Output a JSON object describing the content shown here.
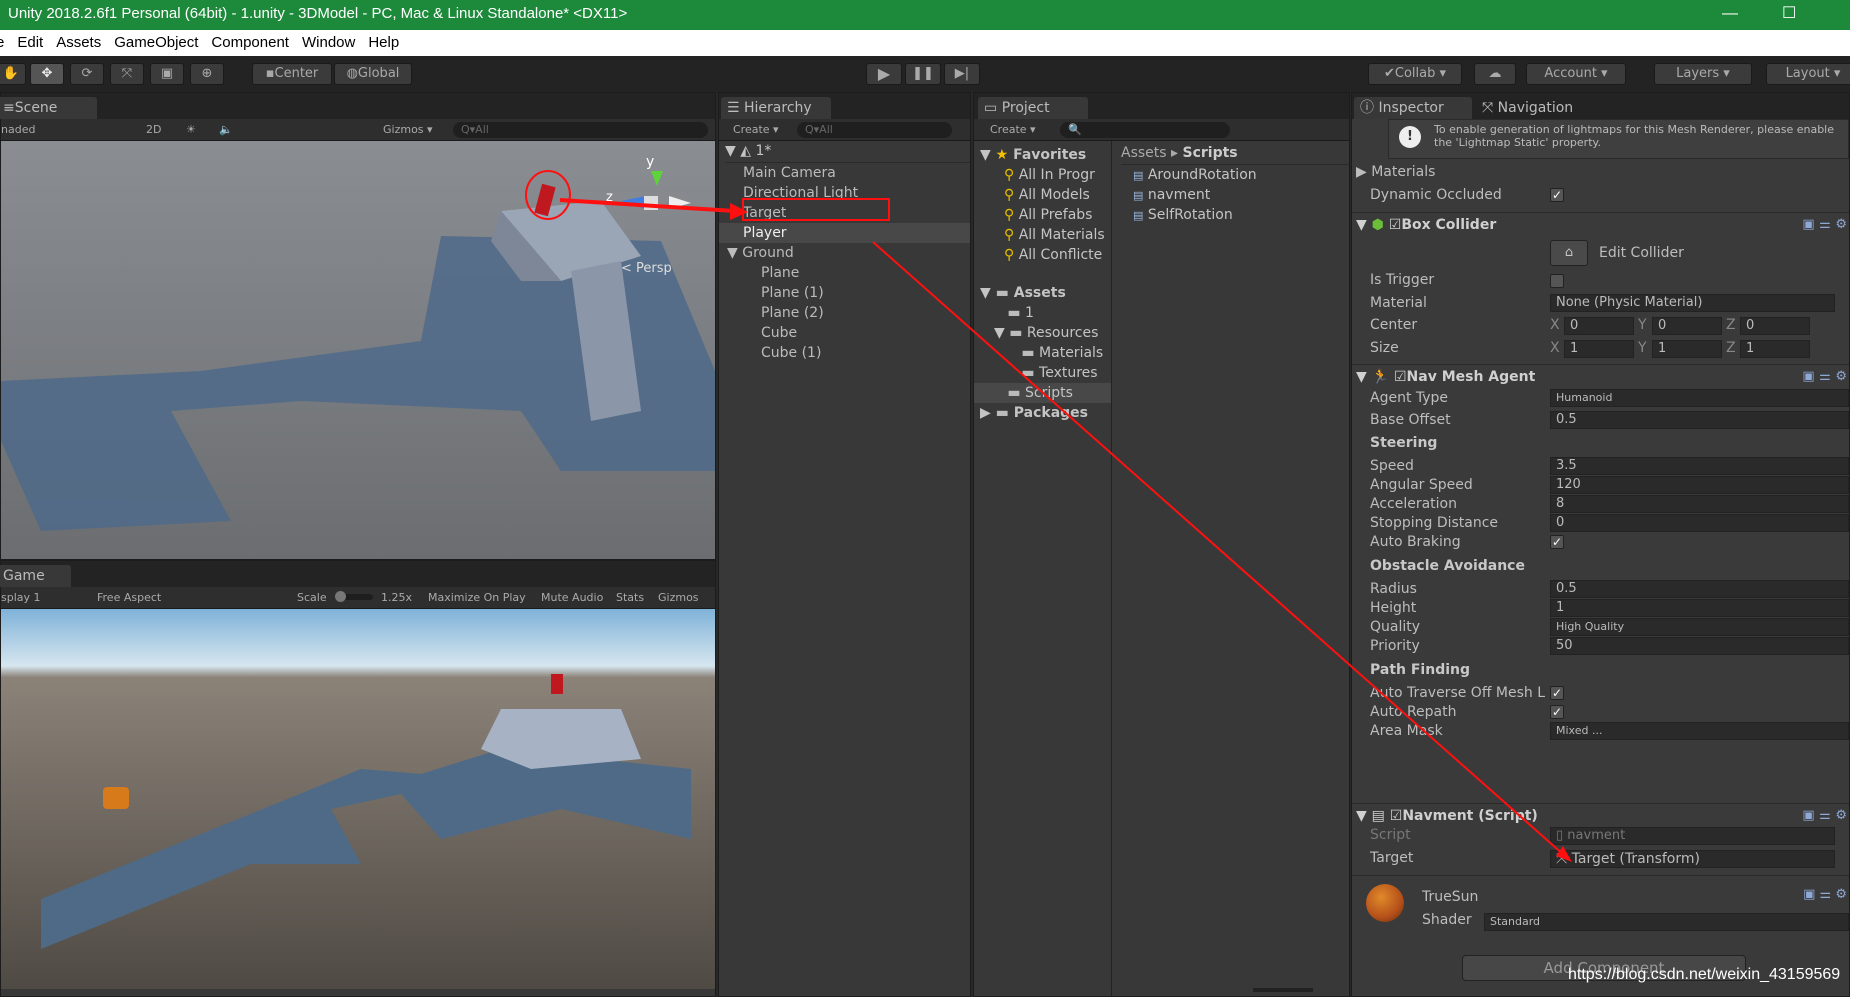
{
  "window": {
    "title": "Unity 2018.2.6f1 Personal (64bit) - 1.unity - 3DModel - PC, Mac & Linux Standalone* <DX11>",
    "minimize": "—",
    "maximize": "☐"
  },
  "menu": [
    "e",
    "Edit",
    "Assets",
    "GameObject",
    "Component",
    "Window",
    "Help"
  ],
  "toolbar": {
    "center": "Center",
    "global": "Global",
    "collab": "Collab ▾",
    "account": "Account ▾",
    "layers": "Layers ▾",
    "layout": "Layout ▾"
  },
  "scene": {
    "tab": "Scene",
    "shading": "naded",
    "mode2d": "2D",
    "gizmos": "Gizmos ▾",
    "search_placeholder": "Q▾All",
    "persp": "< Persp",
    "axis_y": "y",
    "axis_z": "z"
  },
  "game": {
    "tab": "Game",
    "display": "splay 1",
    "aspect": "Free Aspect",
    "scale_label": "Scale",
    "scale_value": "1.25x",
    "scale_fraction": 0.0,
    "maximize": "Maximize On Play",
    "mute": "Mute Audio",
    "stats": "Stats",
    "gizmos": "Gizmos"
  },
  "hierarchy": {
    "tab": "Hierarchy",
    "create": "Create ▾",
    "search_placeholder": "Q▾All",
    "scene_name": "1*",
    "items": [
      {
        "label": "Main Camera",
        "depth": 1
      },
      {
        "label": "Directional Light",
        "depth": 1
      },
      {
        "label": "Target",
        "depth": 1,
        "annotated": true
      },
      {
        "label": "Player",
        "depth": 1,
        "selected": true
      },
      {
        "label": "Ground",
        "depth": 1,
        "expanded": true
      },
      {
        "label": "Plane",
        "depth": 2
      },
      {
        "label": "Plane (1)",
        "depth": 2
      },
      {
        "label": "Plane (2)",
        "depth": 2
      },
      {
        "label": "Cube",
        "depth": 2
      },
      {
        "label": "Cube (1)",
        "depth": 2
      }
    ]
  },
  "project": {
    "tab": "Project",
    "create": "Create ▾",
    "favorites_label": "Favorites",
    "favorites": [
      "All In Progr",
      "All Models",
      "All Prefabs",
      "All Materials",
      "All Conflicte"
    ],
    "tree": [
      {
        "label": "Assets",
        "depth": 0,
        "bold": true,
        "arrow": "▼"
      },
      {
        "label": "1",
        "depth": 1
      },
      {
        "label": "Resources",
        "depth": 1,
        "arrow": "▼"
      },
      {
        "label": "Materials",
        "depth": 2
      },
      {
        "label": "Textures",
        "depth": 2
      },
      {
        "label": "Scripts",
        "depth": 1,
        "selected": true
      },
      {
        "label": "Packages",
        "depth": 0,
        "bold": true,
        "arrow": "▶"
      }
    ],
    "breadcrumb": [
      "Assets",
      "Scripts"
    ],
    "files": [
      "AroundRotation",
      "navment",
      "SelfRotation"
    ]
  },
  "inspector": {
    "tab": "Inspector",
    "nav_tab": "Navigation",
    "info": "To enable generation of lightmaps for this Mesh Renderer, please enable the 'Lightmap Static' property.",
    "materials": "Materials",
    "dynamic_occluded": "Dynamic Occluded",
    "box_collider": {
      "title": "Box Collider",
      "edit": "Edit Collider",
      "is_trigger": "Is Trigger",
      "material_label": "Material",
      "material": "None (Physic Material)",
      "center_label": "Center",
      "size_label": "Size",
      "center": [
        "0",
        "0",
        "0"
      ],
      "size": [
        "1",
        "1",
        "1"
      ],
      "axes": [
        "X",
        "Y",
        "Z"
      ]
    },
    "nav_mesh_agent": {
      "title": "Nav Mesh Agent",
      "agent_type_label": "Agent Type",
      "agent_type": "Humanoid",
      "base_offset_label": "Base Offset",
      "base_offset": "0.5",
      "steering": "Steering",
      "speed_label": "Speed",
      "speed": "3.5",
      "angular_label": "Angular Speed",
      "angular": "120",
      "accel_label": "Acceleration",
      "accel": "8",
      "stopping_label": "Stopping Distance",
      "stopping": "0",
      "braking_label": "Auto Braking",
      "obstacle": "Obstacle Avoidance",
      "radius_label": "Radius",
      "radius": "0.5",
      "height_label": "Height",
      "height": "1",
      "quality_label": "Quality",
      "quality": "High Quality",
      "priority_label": "Priority",
      "priority": "50",
      "path": "Path Finding",
      "traverse_label": "Auto Traverse Off Mesh L",
      "repath_label": "Auto Repath",
      "area_label": "Area Mask",
      "area": "Mixed ..."
    },
    "navment": {
      "title": "Navment (Script)",
      "script_label": "Script",
      "script": "navment",
      "target_label": "Target",
      "target": "Target (Transform)"
    },
    "material": {
      "name": "TrueSun",
      "shader_label": "Shader",
      "shader": "Standard"
    },
    "add_component": "Add Component"
  },
  "watermark": "https://blog.csdn.net/weixin_43159569",
  "colors": {
    "title_bar": "#1d8a3b",
    "annotation": "#ff0000",
    "selection": "#484848"
  }
}
